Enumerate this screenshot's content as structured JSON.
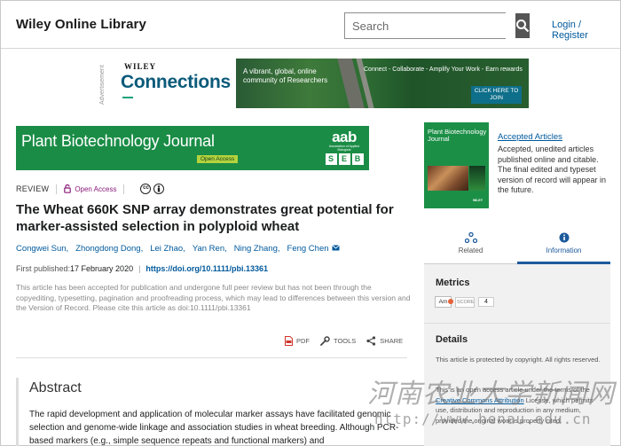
{
  "header": {
    "logo": "Wiley Online Library",
    "search_placeholder": "Search",
    "login": "Login / Register"
  },
  "ad": {
    "label": "Advertisement",
    "brand": "WILEY",
    "title": "Connections",
    "tagline": "A vibrant, global, online community of Researchers",
    "slogan": "Connect - Collaborate - Amplify Your Work - Earn rewards",
    "cta": "CLICK HERE TO JOIN"
  },
  "journal": {
    "name": "Plant Biotechnology Journal",
    "open_access": "Open Access",
    "society_logo": "aab",
    "society_sub": "Association of Applied Biologists",
    "seb_letters": [
      "S",
      "E",
      "B"
    ]
  },
  "article": {
    "type": "REVIEW",
    "access": "Open Access",
    "license_icons": [
      "cc",
      "by"
    ],
    "title": "The Wheat 660K SNP array demonstrates great potential for marker-assisted selection in polyploid wheat",
    "authors": [
      "Congwei Sun,",
      "Zhongdong Dong,",
      "Lei Zhao,",
      "Yan Ren,",
      "Ning Zhang,",
      "Feng Chen"
    ],
    "first_published_label": "First published:",
    "first_published": "17 February 2020",
    "doi": "https://doi.org/10.1111/pbi.13361",
    "accepted_note": "This article has been accepted for publication and undergone full peer review but has not been through the copyediting, typesetting, pagination and proofreading process, which may lead to differences between this version and the Version of Record. Please cite this article as doi:10.1111/pbi.13361",
    "tools": {
      "pdf": "PDF",
      "tools": "TOOLS",
      "share": "SHARE"
    },
    "abstract_title": "Abstract",
    "abstract_text": "The rapid development and application of molecular marker assays have facilitated genomic selection and genome-wide linkage and association studies in wheat breeding. Although PCR-based markers (e.g., simple sequence repeats and functional markers) and"
  },
  "sidebar": {
    "cover_title": "Plant Biotechnology Journal",
    "cover_publisher": "WILEY",
    "accepted_link": "Accepted Articles",
    "accepted_desc": "Accepted, unedited articles published online and citable. The final edited and typeset version of record will appear in the future.",
    "tabs": [
      {
        "label": "Related",
        "icon": "related-icon"
      },
      {
        "label": "Information",
        "icon": "info-icon"
      }
    ],
    "metrics_title": "Metrics",
    "altmetric_badge": "Am",
    "score_label": "SCORE",
    "score_value": "4",
    "details_title": "Details",
    "details_copyright": "This article is protected by copyright. All rights reserved.",
    "details_license_pre": "This is an open access article under the terms of the ",
    "details_license_link": "Creative Commons Attribution",
    "details_license_post": " License, which permits use, distribution and reproduction in any medium, provided the original work is properly cited."
  },
  "watermark": {
    "cn": "河南农业大学新闻网",
    "url": "http://www.henau.edu.cn"
  },
  "colors": {
    "link": "#00599c",
    "journal_green": "#1a8c46",
    "open_access_purple": "#8a1a7a"
  }
}
